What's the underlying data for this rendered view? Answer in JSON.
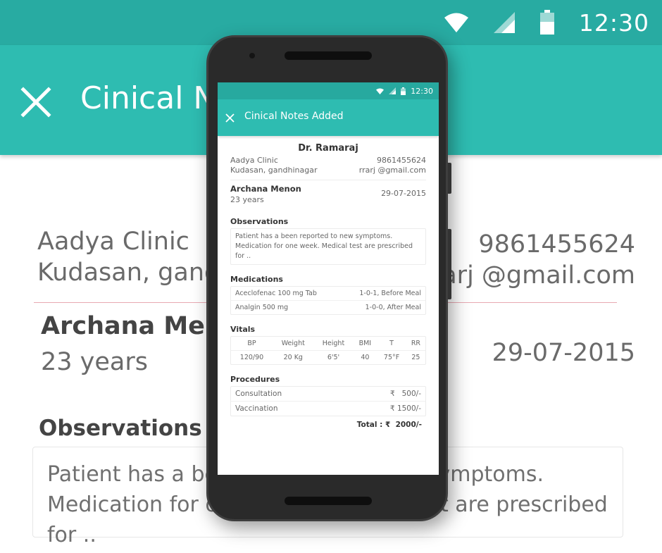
{
  "status_bar": {
    "time": "12:30"
  },
  "background": {
    "title": "Cinical Notes Added",
    "clinic_name": "Aadya Clinic",
    "clinic_address": "Kudasan, gandhinagar",
    "phone": "9861455624",
    "email": "rrarj @gmail.com",
    "patient_name": "Archana Menon",
    "patient_age": "23 years",
    "visit_date": "29-07-2015",
    "observations_heading": "Observations",
    "observations_text": "Patient has a been reported to new symptoms. Medication for one week. Medical test are prescribed for .."
  },
  "phone_screen": {
    "time": "12:30",
    "title": "Cinical Notes Added",
    "doctor": "Dr.  Ramaraj",
    "clinic_name": "Aadya Clinic",
    "clinic_address": "Kudasan, gandhinagar",
    "phone": "9861455624",
    "email": "rrarj @gmail.com",
    "patient_name": "Archana Menon",
    "patient_age": "23 years",
    "visit_date": "29-07-2015",
    "observations_heading": "Observations",
    "observations_text": "Patient has a been reported to new symptoms. Medication for one week. Medical test are prescribed for ..",
    "medications_heading": "Medications",
    "medications": [
      {
        "name": "Aceclofenac 100 mg Tab",
        "dosage": "1-0-1, Before Meal"
      },
      {
        "name": "Analgin 500 mg",
        "dosage": "1-0-0, After Meal"
      }
    ],
    "vitals_heading": "Vitals",
    "vitals_headers": [
      "BP",
      "Weight",
      "Height",
      "BMI",
      "T",
      "RR"
    ],
    "vitals_values": [
      "120/90",
      "20 Kg",
      "6'5'",
      "40",
      "75°F",
      "25"
    ],
    "procedures_heading": "Procedures",
    "procedures": [
      {
        "name": "Consultation",
        "price": "₹   500/-"
      },
      {
        "name": "Vaccination",
        "price": "₹ 1500/-"
      }
    ],
    "total_label": "Total :",
    "total_value": "₹  2000/-"
  },
  "colors": {
    "accent": "#2ebcb1",
    "status_bar": "#28aba2",
    "divider": "#e8a8b2"
  },
  "icons": [
    "wifi-icon",
    "cellular-signal-icon",
    "battery-icon",
    "close-icon"
  ]
}
